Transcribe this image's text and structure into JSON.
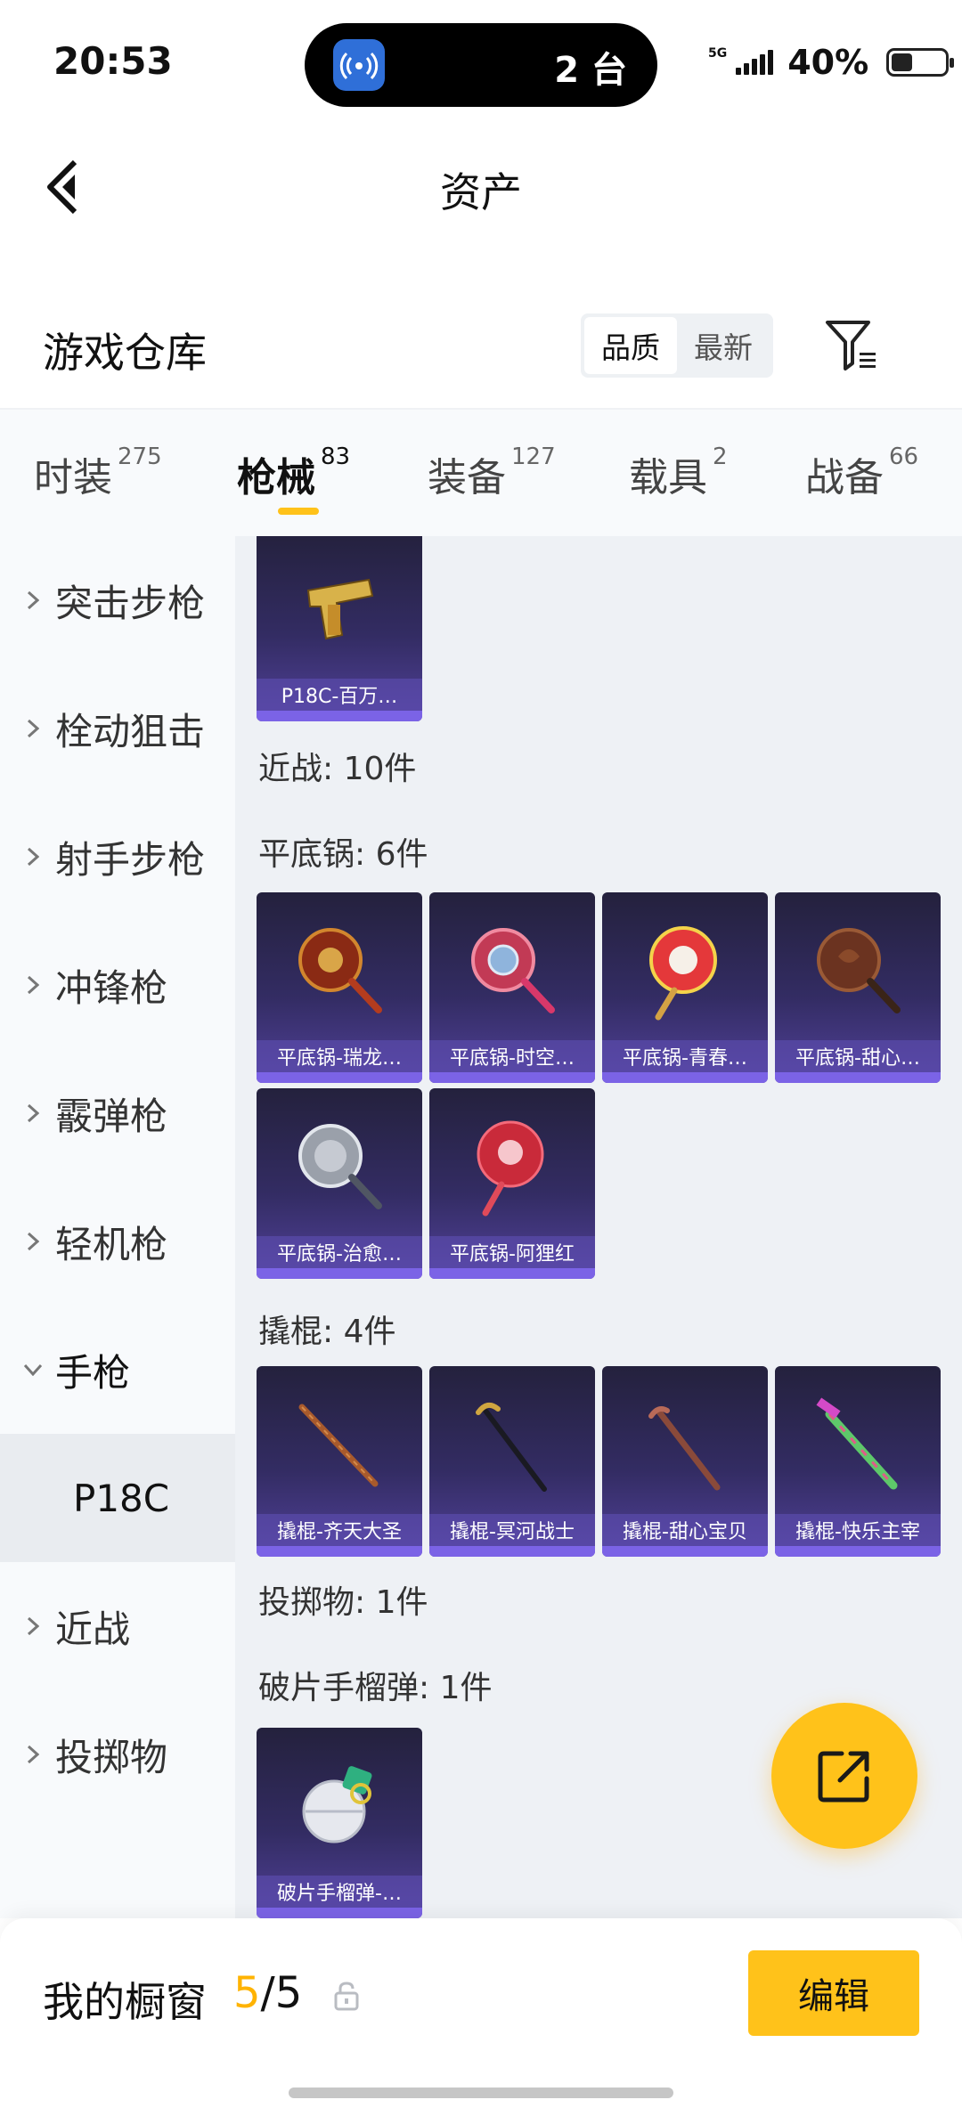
{
  "status_bar": {
    "time": "20:53",
    "island_count": "2 台",
    "network": "5G",
    "battery": "40%",
    "battery_level": 0.4
  },
  "header": {
    "title": "资产"
  },
  "warehouse": {
    "title": "游戏仓库",
    "sort_options": [
      "品质",
      "最新"
    ],
    "active_sort": "品质"
  },
  "categories": [
    {
      "label": "时装",
      "count": "275"
    },
    {
      "label": "枪械",
      "count": "83",
      "active": true
    },
    {
      "label": "装备",
      "count": "127"
    },
    {
      "label": "载具",
      "count": "2"
    },
    {
      "label": "战备",
      "count": "66"
    }
  ],
  "sidebar": {
    "items": [
      {
        "label": "突击步枪"
      },
      {
        "label": "栓动狙击"
      },
      {
        "label": "射手步枪"
      },
      {
        "label": "冲锋枪"
      },
      {
        "label": "霰弹枪"
      },
      {
        "label": "轻机枪"
      },
      {
        "label": "手枪",
        "expanded": true
      },
      {
        "label": "近战"
      },
      {
        "label": "投掷物"
      }
    ],
    "sub_item": "P18C"
  },
  "content": {
    "pistol_items": [
      {
        "name": "P18C-百万…",
        "icon": "golden-pistol"
      }
    ],
    "melee_header": "近战: 10件",
    "pan_header": "平底锅: 6件",
    "pan_items": [
      {
        "name": "平底锅-瑞龙…",
        "icon": "dragon-pan"
      },
      {
        "name": "平底锅-时空…",
        "icon": "timespace-pan"
      },
      {
        "name": "平底锅-青春…",
        "icon": "youth-pan"
      },
      {
        "name": "平底锅-甜心…",
        "icon": "sweetheart-pan"
      },
      {
        "name": "平底锅-治愈…",
        "icon": "healing-pan"
      },
      {
        "name": "平底锅-阿狸红",
        "icon": "ahri-red-pan"
      }
    ],
    "crowbar_header": "撬棍: 4件",
    "crowbar_items": [
      {
        "name": "撬棍-齐天大圣",
        "icon": "monkey-king-staff"
      },
      {
        "name": "撬棍-冥河战士",
        "icon": "styx-warrior-crowbar"
      },
      {
        "name": "撬棍-甜心宝贝",
        "icon": "sweetheart-crowbar"
      },
      {
        "name": "撬棍-快乐主宰",
        "icon": "joy-master-crowbar"
      }
    ],
    "throwable_header": "投掷物: 1件",
    "grenade_header": "破片手榴弹: 1件",
    "grenade_items": [
      {
        "name": "破片手榴弹-…",
        "icon": "frag-grenade"
      }
    ]
  },
  "bottom_bar": {
    "label": "我的橱窗",
    "current": "5",
    "total": "/5",
    "edit_label": "编辑"
  },
  "colors": {
    "accent": "#ffc21a",
    "card_bg": "#332c63",
    "rarity_purple": "#7b63e6"
  }
}
